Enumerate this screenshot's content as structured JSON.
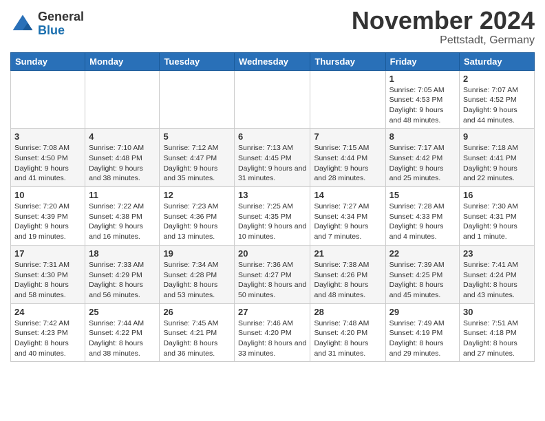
{
  "logo": {
    "general": "General",
    "blue": "Blue"
  },
  "title": "November 2024",
  "location": "Pettstadt, Germany",
  "days_of_week": [
    "Sunday",
    "Monday",
    "Tuesday",
    "Wednesday",
    "Thursday",
    "Friday",
    "Saturday"
  ],
  "weeks": [
    [
      {
        "day": "",
        "info": ""
      },
      {
        "day": "",
        "info": ""
      },
      {
        "day": "",
        "info": ""
      },
      {
        "day": "",
        "info": ""
      },
      {
        "day": "",
        "info": ""
      },
      {
        "day": "1",
        "info": "Sunrise: 7:05 AM\nSunset: 4:53 PM\nDaylight: 9 hours and 48 minutes."
      },
      {
        "day": "2",
        "info": "Sunrise: 7:07 AM\nSunset: 4:52 PM\nDaylight: 9 hours and 44 minutes."
      }
    ],
    [
      {
        "day": "3",
        "info": "Sunrise: 7:08 AM\nSunset: 4:50 PM\nDaylight: 9 hours and 41 minutes."
      },
      {
        "day": "4",
        "info": "Sunrise: 7:10 AM\nSunset: 4:48 PM\nDaylight: 9 hours and 38 minutes."
      },
      {
        "day": "5",
        "info": "Sunrise: 7:12 AM\nSunset: 4:47 PM\nDaylight: 9 hours and 35 minutes."
      },
      {
        "day": "6",
        "info": "Sunrise: 7:13 AM\nSunset: 4:45 PM\nDaylight: 9 hours and 31 minutes."
      },
      {
        "day": "7",
        "info": "Sunrise: 7:15 AM\nSunset: 4:44 PM\nDaylight: 9 hours and 28 minutes."
      },
      {
        "day": "8",
        "info": "Sunrise: 7:17 AM\nSunset: 4:42 PM\nDaylight: 9 hours and 25 minutes."
      },
      {
        "day": "9",
        "info": "Sunrise: 7:18 AM\nSunset: 4:41 PM\nDaylight: 9 hours and 22 minutes."
      }
    ],
    [
      {
        "day": "10",
        "info": "Sunrise: 7:20 AM\nSunset: 4:39 PM\nDaylight: 9 hours and 19 minutes."
      },
      {
        "day": "11",
        "info": "Sunrise: 7:22 AM\nSunset: 4:38 PM\nDaylight: 9 hours and 16 minutes."
      },
      {
        "day": "12",
        "info": "Sunrise: 7:23 AM\nSunset: 4:36 PM\nDaylight: 9 hours and 13 minutes."
      },
      {
        "day": "13",
        "info": "Sunrise: 7:25 AM\nSunset: 4:35 PM\nDaylight: 9 hours and 10 minutes."
      },
      {
        "day": "14",
        "info": "Sunrise: 7:27 AM\nSunset: 4:34 PM\nDaylight: 9 hours and 7 minutes."
      },
      {
        "day": "15",
        "info": "Sunrise: 7:28 AM\nSunset: 4:33 PM\nDaylight: 9 hours and 4 minutes."
      },
      {
        "day": "16",
        "info": "Sunrise: 7:30 AM\nSunset: 4:31 PM\nDaylight: 9 hours and 1 minute."
      }
    ],
    [
      {
        "day": "17",
        "info": "Sunrise: 7:31 AM\nSunset: 4:30 PM\nDaylight: 8 hours and 58 minutes."
      },
      {
        "day": "18",
        "info": "Sunrise: 7:33 AM\nSunset: 4:29 PM\nDaylight: 8 hours and 56 minutes."
      },
      {
        "day": "19",
        "info": "Sunrise: 7:34 AM\nSunset: 4:28 PM\nDaylight: 8 hours and 53 minutes."
      },
      {
        "day": "20",
        "info": "Sunrise: 7:36 AM\nSunset: 4:27 PM\nDaylight: 8 hours and 50 minutes."
      },
      {
        "day": "21",
        "info": "Sunrise: 7:38 AM\nSunset: 4:26 PM\nDaylight: 8 hours and 48 minutes."
      },
      {
        "day": "22",
        "info": "Sunrise: 7:39 AM\nSunset: 4:25 PM\nDaylight: 8 hours and 45 minutes."
      },
      {
        "day": "23",
        "info": "Sunrise: 7:41 AM\nSunset: 4:24 PM\nDaylight: 8 hours and 43 minutes."
      }
    ],
    [
      {
        "day": "24",
        "info": "Sunrise: 7:42 AM\nSunset: 4:23 PM\nDaylight: 8 hours and 40 minutes."
      },
      {
        "day": "25",
        "info": "Sunrise: 7:44 AM\nSunset: 4:22 PM\nDaylight: 8 hours and 38 minutes."
      },
      {
        "day": "26",
        "info": "Sunrise: 7:45 AM\nSunset: 4:21 PM\nDaylight: 8 hours and 36 minutes."
      },
      {
        "day": "27",
        "info": "Sunrise: 7:46 AM\nSunset: 4:20 PM\nDaylight: 8 hours and 33 minutes."
      },
      {
        "day": "28",
        "info": "Sunrise: 7:48 AM\nSunset: 4:20 PM\nDaylight: 8 hours and 31 minutes."
      },
      {
        "day": "29",
        "info": "Sunrise: 7:49 AM\nSunset: 4:19 PM\nDaylight: 8 hours and 29 minutes."
      },
      {
        "day": "30",
        "info": "Sunrise: 7:51 AM\nSunset: 4:18 PM\nDaylight: 8 hours and 27 minutes."
      }
    ]
  ]
}
